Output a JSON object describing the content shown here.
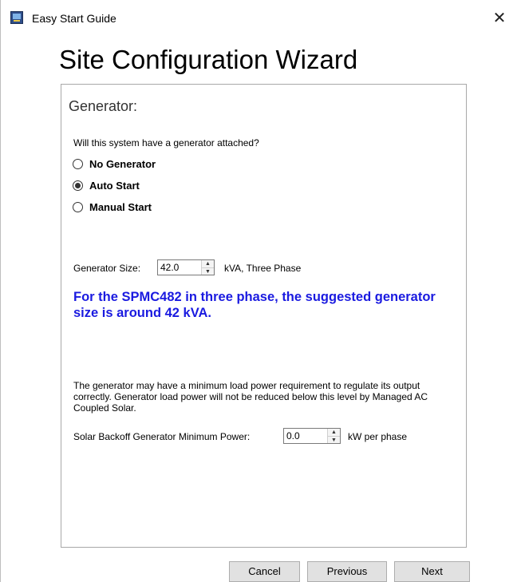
{
  "window": {
    "title": "Easy Start Guide",
    "app_icon": "app-icon",
    "close_symbol": "✕"
  },
  "wizard": {
    "heading": "Site Configuration Wizard",
    "section_title": "Generator:",
    "question": "Will this system have a generator attached?",
    "options": [
      {
        "label": "No Generator",
        "selected": false
      },
      {
        "label": "Auto Start",
        "selected": true
      },
      {
        "label": "Manual Start",
        "selected": false
      }
    ],
    "generator_size": {
      "label": "Generator Size:",
      "value": "42.0",
      "unit": "kVA, Three Phase"
    },
    "suggestion": "For the SPMC482 in three phase, the suggested generator size is around 42 kVA.",
    "note": "The generator may have a minimum load power requirement to regulate its output correctly. Generator load power will not be reduced below this level by Managed AC Coupled Solar.",
    "min_power": {
      "label": "Solar Backoff Generator Minimum Power:",
      "value": "0.0",
      "unit": "kW per phase"
    }
  },
  "footer": {
    "cancel": "Cancel",
    "previous": "Previous",
    "next": "Next"
  },
  "colors": {
    "suggestion_text": "#1a1ae0",
    "button_bg": "#e1e1e1"
  }
}
